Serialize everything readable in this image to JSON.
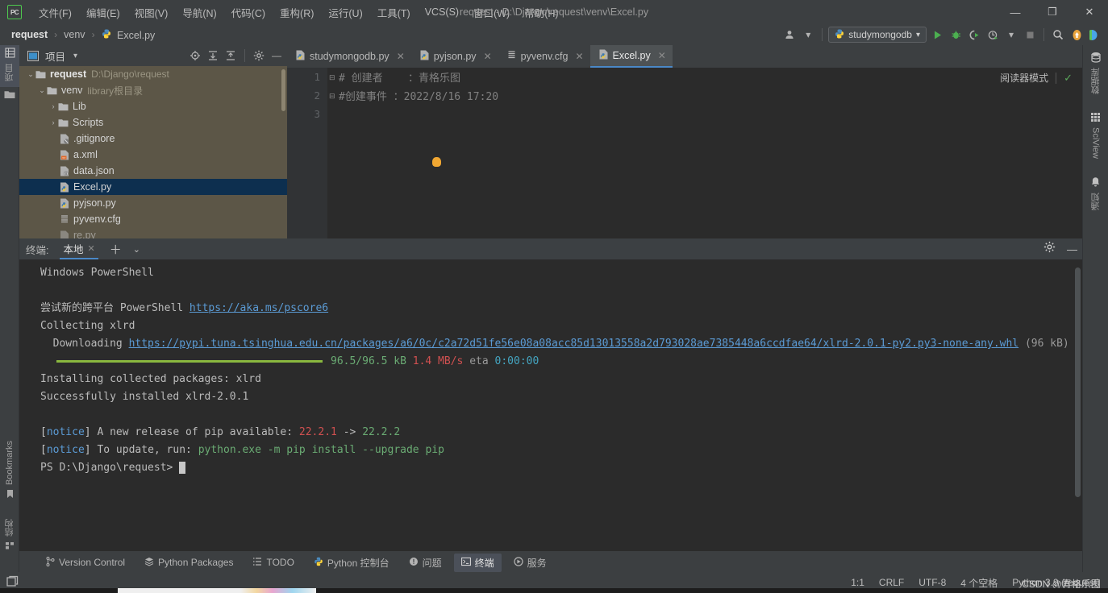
{
  "window": {
    "title": "request - D:\\Django\\request\\venv\\Excel.py",
    "logo": "PC",
    "minimize": "—",
    "restore": "❐",
    "close": "✕"
  },
  "menu": {
    "items": [
      {
        "label": "文件(F)",
        "name": "menu-file"
      },
      {
        "label": "编辑(E)",
        "name": "menu-edit"
      },
      {
        "label": "视图(V)",
        "name": "menu-view"
      },
      {
        "label": "导航(N)",
        "name": "menu-navigate"
      },
      {
        "label": "代码(C)",
        "name": "menu-code"
      },
      {
        "label": "重构(R)",
        "name": "menu-refactor"
      },
      {
        "label": "运行(U)",
        "name": "menu-run"
      },
      {
        "label": "工具(T)",
        "name": "menu-tools"
      },
      {
        "label": "VCS(S)",
        "name": "menu-vcs"
      },
      {
        "label": "窗口(W)",
        "name": "menu-window"
      },
      {
        "label": "帮助(H)",
        "name": "menu-help"
      }
    ]
  },
  "breadcrumb": {
    "project": "request",
    "sep": "›",
    "folder": "venv",
    "file": "Excel.py"
  },
  "toolbar": {
    "account_icon": "Д",
    "run_config": "studymongodb",
    "run_icon": "▶",
    "debug_icon": "🐞",
    "coverage_icon": "◑",
    "profile_icon": "◴",
    "stop_icon": "■",
    "search_icon": "🔍",
    "update_icon": "⬆",
    "ide_icon": "◗",
    "dropdown": "▾"
  },
  "left_stripe": {
    "project_label": "项目",
    "bookmarks_label": "Bookmarks",
    "structure_label": "结构"
  },
  "right_stripe": {
    "items": [
      {
        "label": "数据库",
        "icon": "database-icon"
      },
      {
        "label": "SciView",
        "icon": "grid-icon"
      },
      {
        "label": "通知",
        "icon": "bell-icon"
      }
    ]
  },
  "project_panel": {
    "title": "项目",
    "dropdown": "▾",
    "actions": {
      "locate": "⊕",
      "expand": "⤓",
      "collapse": "⤒",
      "settings": "⚙",
      "hide": "—"
    },
    "tree": [
      {
        "indent": 0,
        "arrow": "⌄",
        "icon": "folder-icon",
        "label": "request",
        "bold": true,
        "sub": "D:\\Django\\request",
        "selected": false
      },
      {
        "indent": 1,
        "arrow": "⌄",
        "icon": "folder-icon",
        "label": "venv",
        "bold": false,
        "sub": "library根目录",
        "selected": false
      },
      {
        "indent": 2,
        "arrow": "›",
        "icon": "folder-icon",
        "label": "Lib",
        "bold": false,
        "sub": "",
        "selected": false
      },
      {
        "indent": 2,
        "arrow": "›",
        "icon": "folder-icon",
        "label": "Scripts",
        "bold": false,
        "sub": "",
        "selected": false
      },
      {
        "indent": 3,
        "arrow": "",
        "icon": "gitignore-icon",
        "label": ".gitignore",
        "bold": false,
        "sub": "",
        "selected": false
      },
      {
        "indent": 3,
        "arrow": "",
        "icon": "xml-icon",
        "label": "a.xml",
        "bold": false,
        "sub": "",
        "selected": false
      },
      {
        "indent": 3,
        "arrow": "",
        "icon": "json-icon",
        "label": "data.json",
        "bold": false,
        "sub": "",
        "selected": false
      },
      {
        "indent": 3,
        "arrow": "",
        "icon": "python-icon",
        "label": "Excel.py",
        "bold": false,
        "sub": "",
        "selected": true
      },
      {
        "indent": 3,
        "arrow": "",
        "icon": "python-icon",
        "label": "pyjson.py",
        "bold": false,
        "sub": "",
        "selected": false
      },
      {
        "indent": 3,
        "arrow": "",
        "icon": "cfg-icon",
        "label": "pyvenv.cfg",
        "bold": false,
        "sub": "",
        "selected": false
      }
    ]
  },
  "editor": {
    "tabs": [
      {
        "label": "studymongodb.py",
        "icon": "python-icon",
        "active": false,
        "close": "✕"
      },
      {
        "label": "pyjson.py",
        "icon": "python-icon",
        "active": false,
        "close": "✕"
      },
      {
        "label": "pyvenv.cfg",
        "icon": "cfg-icon",
        "active": false,
        "close": "✕"
      },
      {
        "label": "Excel.py",
        "icon": "python-icon",
        "active": true,
        "close": "✕"
      }
    ],
    "more_tabs": "⋮",
    "reader_mode": "阅读器模式",
    "inspection_ok": "✓",
    "line_numbers": [
      "1",
      "2",
      "3"
    ],
    "lines": [
      "# 创建者    ：青格乐图",
      "#创建事件 ：2022/8/16 17:20",
      ""
    ]
  },
  "terminal": {
    "label": "终端:",
    "tab": "本地",
    "tab_close": "✕",
    "add": "＋",
    "chevron": "⌄",
    "settings": "⚙",
    "hide": "—",
    "lines": [
      {
        "type": "plain",
        "text": "Windows PowerShell"
      },
      {
        "type": "blank"
      },
      {
        "type": "ps_link",
        "prefix": "尝试新的跨平台 PowerShell ",
        "link": "https://aka.ms/pscore6"
      },
      {
        "type": "plain",
        "text": "Collecting xlrd"
      },
      {
        "type": "download",
        "prefix": "  Downloading ",
        "link": "https://pypi.tuna.tsinghua.edu.cn/packages/a6/0c/c2a72d51fe56e08a08acc85d13013558a2d793028ae7385448a6ccdfae64/xlrd-2.0.1-py2.py3-none-any.whl",
        "suffix": " (96 kB)"
      },
      {
        "type": "progress",
        "size": "96.5/96.5 kB",
        "speed": "1.4 MB/s",
        "eta_label": "eta",
        "eta": "0:00:00"
      },
      {
        "type": "plain",
        "text": "Installing collected packages: xlrd"
      },
      {
        "type": "plain",
        "text": "Successfully installed xlrd-2.0.1"
      },
      {
        "type": "blank"
      },
      {
        "type": "notice1",
        "bracket_l": "[",
        "word": "notice",
        "bracket_r": "]",
        "text": " A new release of pip available: ",
        "old": "22.2.1",
        "arrow": " -> ",
        "new": "22.2.2"
      },
      {
        "type": "notice2",
        "bracket_l": "[",
        "word": "notice",
        "bracket_r": "]",
        "text": " To update, run: ",
        "cmd": "python.exe -m pip install --upgrade pip"
      },
      {
        "type": "prompt",
        "text": "PS D:\\Django\\request> "
      }
    ]
  },
  "toolwindow_bar": {
    "items": [
      {
        "label": "Version Control",
        "icon": "branch-icon",
        "active": false
      },
      {
        "label": "Python Packages",
        "icon": "packages-icon",
        "active": false
      },
      {
        "label": "TODO",
        "icon": "todo-icon",
        "active": false
      },
      {
        "label": "Python 控制台",
        "icon": "console-icon",
        "active": false
      },
      {
        "label": "问题",
        "icon": "problems-icon",
        "active": false
      },
      {
        "label": "终端",
        "icon": "terminal-icon",
        "active": true
      },
      {
        "label": "服务",
        "icon": "services-icon",
        "active": false
      }
    ]
  },
  "statusbar": {
    "toggle_icon": "❐",
    "position": "1:1",
    "line_sep": "CRLF",
    "encoding": "UTF-8",
    "indent": "4 个空格",
    "interpreter": "Python 3.9 (request)",
    "watermark": "CSDN @青格乐图"
  },
  "colors": {
    "accent": "#4a88c7",
    "selection": "#0d2f4f",
    "tree_bg": "#5c5647",
    "editor_bg": "#2b2b2b",
    "chrome": "#3c3f41",
    "link": "#5b9bd5",
    "green": "#6aab73",
    "red": "#d05050",
    "progress": "#8ab83f"
  }
}
